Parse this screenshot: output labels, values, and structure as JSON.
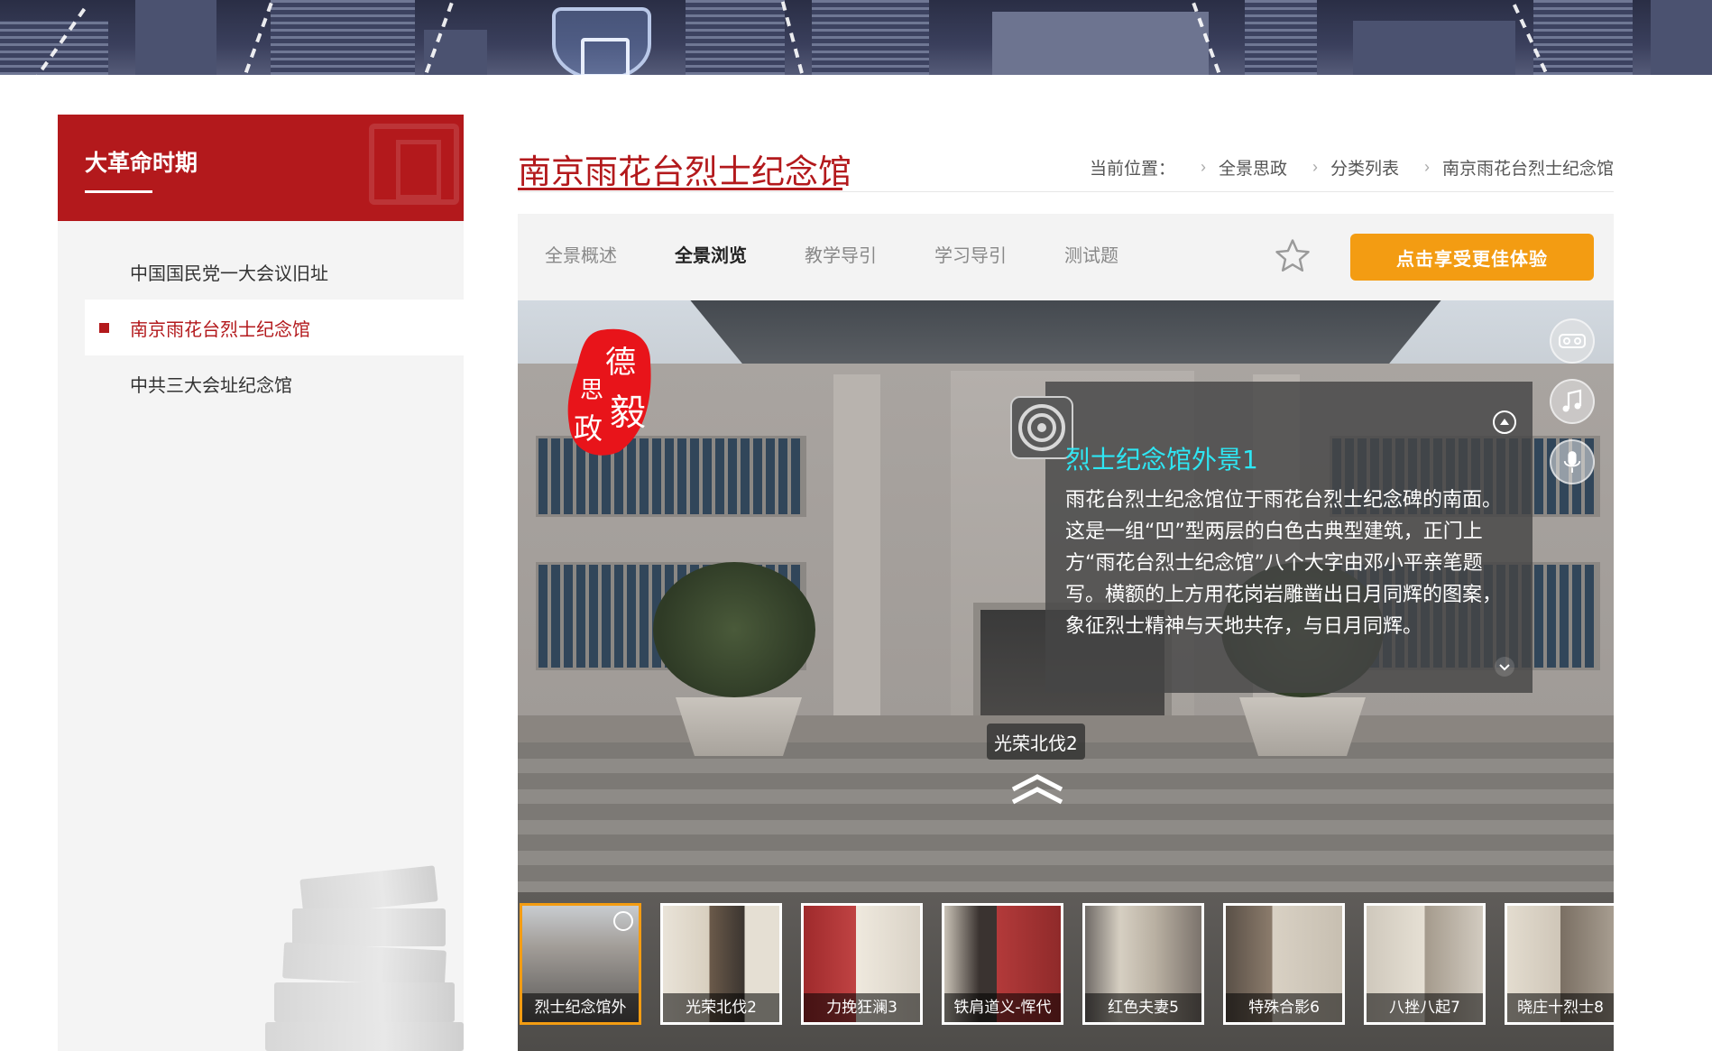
{
  "sidebar": {
    "title": "大革命时期",
    "items": [
      {
        "label": "中国国民党一大会议旧址",
        "active": false
      },
      {
        "label": "南京雨花台烈士纪念馆",
        "active": true
      },
      {
        "label": "中共三大会址纪念馆",
        "active": false
      }
    ]
  },
  "main": {
    "title": "南京雨花台烈士纪念馆",
    "breadcrumb": {
      "label": "当前位置：",
      "items": [
        "全景思政",
        "分类列表",
        "南京雨花台烈士纪念馆"
      ]
    },
    "tabs": [
      {
        "label": "全景概述",
        "active": false
      },
      {
        "label": "全景浏览",
        "active": true
      },
      {
        "label": "教学导引",
        "active": false
      },
      {
        "label": "学习导引",
        "active": false
      },
      {
        "label": "测试题",
        "active": false
      }
    ],
    "favorite_icon": "star-icon",
    "cta_label": "点击享受更佳体验"
  },
  "viewer": {
    "logo_text": [
      "德",
      "思",
      "政",
      "毅"
    ],
    "controls": [
      "vr-glasses-icon",
      "music-icon",
      "microphone-icon"
    ],
    "info": {
      "title": "烈士纪念馆外景1",
      "text": "雨花台烈士纪念馆位于雨花台烈士纪念碑的南面。这是一组“凹”型两层的白色古典型建筑，正门上方“雨花台烈士纪念馆”八个大字由邓小平亲笔题写。横额的上方用花岗岩雕凿出日月同辉的图案，象征烈士精神与天地共存，与日月同辉。"
    },
    "hotspot_label": "光荣北伐2",
    "thumbnails": [
      {
        "label": "烈士纪念馆外",
        "active": true
      },
      {
        "label": "光荣北伐2",
        "active": false
      },
      {
        "label": "力挽狂澜3",
        "active": false
      },
      {
        "label": "铁肩道义-恽代",
        "active": false
      },
      {
        "label": "红色夫妻5",
        "active": false
      },
      {
        "label": "特殊合影6",
        "active": false
      },
      {
        "label": "八挫八起7",
        "active": false
      },
      {
        "label": "晓庄十烈士8",
        "active": false
      }
    ]
  },
  "colors": {
    "brand_red": "#b3191c",
    "accent_orange": "#f39c12",
    "info_title_cyan": "#2ee6f3"
  }
}
